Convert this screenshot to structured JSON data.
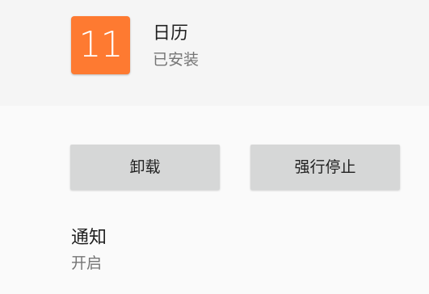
{
  "app": {
    "icon_text": "11",
    "icon_color": "#fe7a31",
    "name": "日历",
    "status": "已安装"
  },
  "actions": {
    "uninstall_label": "卸载",
    "force_stop_label": "强行停止"
  },
  "notifications": {
    "title": "通知",
    "value": "开启"
  }
}
